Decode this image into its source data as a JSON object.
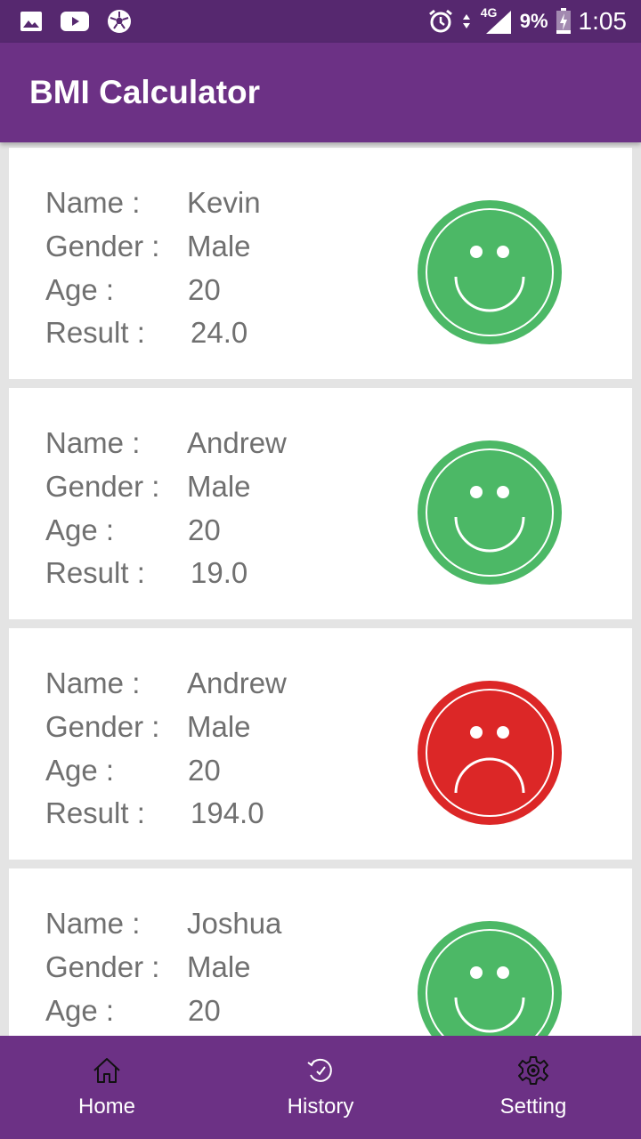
{
  "status_bar": {
    "icons_left": [
      "image-icon",
      "youtube-icon",
      "soccer-ball-icon"
    ],
    "icons_right": [
      "alarm-icon",
      "data-arrows-icon",
      "signal-4g-icon",
      "battery-charging-icon"
    ],
    "network": "4G",
    "battery": "9%",
    "time": "1:05"
  },
  "app_bar": {
    "title": "BMI Calculator",
    "color": "#6c3185"
  },
  "labels": {
    "name": "Name :",
    "gender": "Gender :",
    "age": "Age :",
    "result": "Result :"
  },
  "records": [
    {
      "name": "Kevin",
      "gender": "Male",
      "age": "20",
      "result": "24.0",
      "status": "happy",
      "color": "#4cb866"
    },
    {
      "name": "Andrew",
      "gender": "Male",
      "age": "20",
      "result": "19.0",
      "status": "happy",
      "color": "#4cb866"
    },
    {
      "name": "Andrew",
      "gender": "Male",
      "age": "20",
      "result": "194.0",
      "status": "sad",
      "color": "#dc2727"
    },
    {
      "name": "Joshua",
      "gender": "Male",
      "age": "20",
      "result": "",
      "status": "happy",
      "color": "#4cb866"
    }
  ],
  "bottom_nav": {
    "items": [
      {
        "label": "Home",
        "icon": "home-icon"
      },
      {
        "label": "History",
        "icon": "history-icon"
      },
      {
        "label": "Setting",
        "icon": "gear-icon"
      }
    ]
  }
}
